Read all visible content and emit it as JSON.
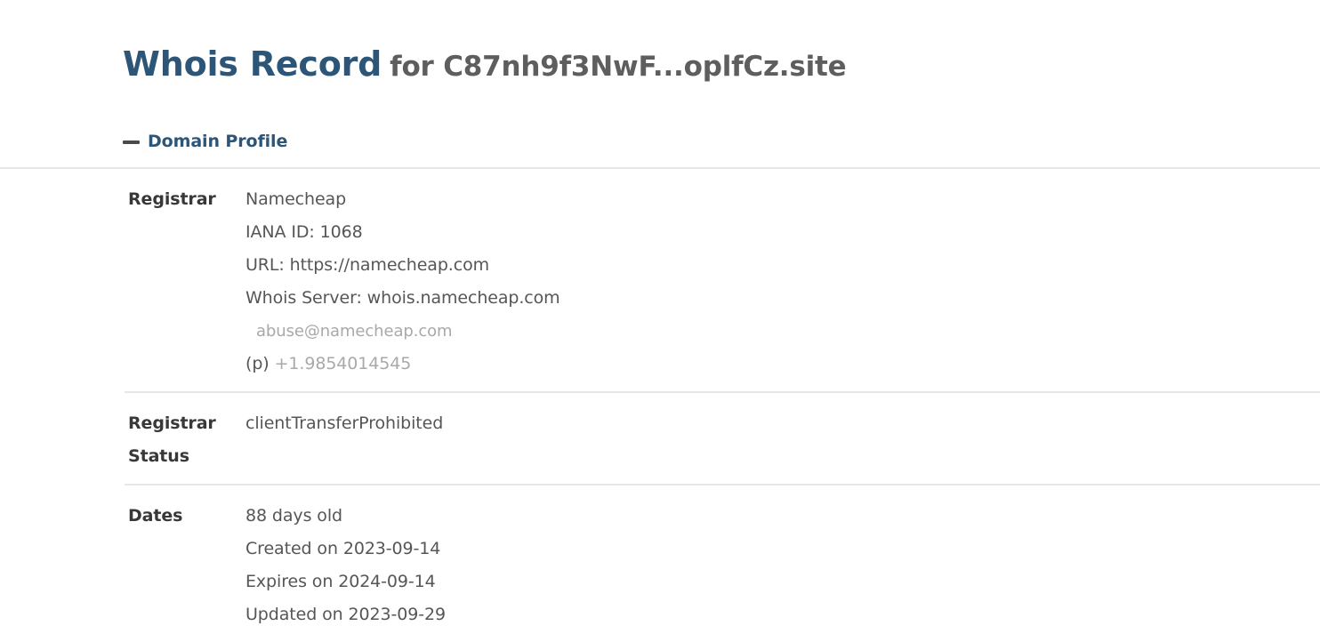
{
  "header": {
    "title": "Whois Record",
    "subtitle": "for C87nh9f3NwF...oplfCz.site"
  },
  "section": {
    "collapse_icon": "minus-icon",
    "title": "Domain Profile",
    "expanded": true
  },
  "rows": [
    {
      "label": "Registrar",
      "lines": [
        "Namecheap",
        "IANA ID: 1068",
        "URL: https://namecheap.com",
        "Whois Server: whois.namecheap.com"
      ],
      "email": "abuse@namecheap.com",
      "phone_label": "(p)",
      "phone": "+1.9854014545"
    },
    {
      "label": "Registrar Status",
      "lines": [
        "clientTransferProhibited"
      ]
    },
    {
      "label": "Dates",
      "lines": [
        "88 days old",
        "Created on 2023-09-14",
        "Expires on 2024-09-14",
        "Updated on 2023-09-29"
      ]
    }
  ],
  "colors": {
    "accent": "#2c5577",
    "label_text": "#383838",
    "value_text": "#565656",
    "muted_text": "#a9a9a9",
    "divider": "#e6e6e6",
    "background": "#ffffff"
  }
}
